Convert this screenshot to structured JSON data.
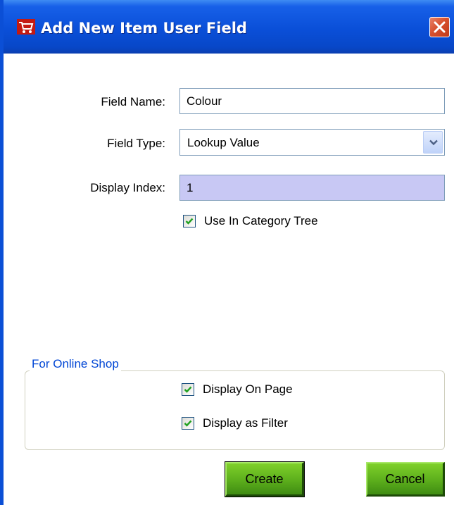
{
  "window": {
    "title": "Add New Item User Field",
    "icon": "shopping-cart-icon",
    "close_icon": "close-icon"
  },
  "form": {
    "field_name": {
      "label": "Field Name:",
      "value": "Colour"
    },
    "field_type": {
      "label": "Field Type:",
      "value": "Lookup Value"
    },
    "display_index": {
      "label": "Display Index:",
      "value": "1"
    },
    "use_in_category_tree": {
      "label": "Use In Category Tree",
      "checked": true
    }
  },
  "online_shop": {
    "legend": "For Online Shop",
    "display_on_page": {
      "label": "Display On Page",
      "checked": true
    },
    "display_as_filter": {
      "label": "Display as Filter",
      "checked": true
    }
  },
  "buttons": {
    "create": "Create",
    "cancel": "Cancel"
  },
  "colors": {
    "titlebar": "#0a4fd8",
    "active_field": "#c8c8f4",
    "group_legend": "#0046d5",
    "button_green": "#5cae1c",
    "checkmark": "#21a121"
  }
}
